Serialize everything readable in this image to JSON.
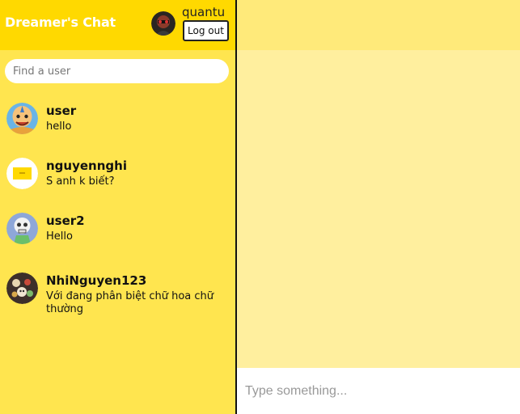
{
  "header": {
    "app_title": "Dreamer's Chat",
    "current_user": "quantu",
    "logout_label": "Log out"
  },
  "search": {
    "placeholder": "Find a user"
  },
  "contacts": [
    {
      "name": "user",
      "last_message": "hello",
      "avatar_icon": "cartoon-boy-avatar"
    },
    {
      "name": "nguyennghi",
      "last_message": "S anh k biết?",
      "avatar_icon": "yellow-card-avatar"
    },
    {
      "name": "user2",
      "last_message": "Hello",
      "avatar_icon": "skeleton-cartoon-avatar"
    },
    {
      "name": "NhiNguyen123",
      "last_message": "Với đang phân biệt chữ hoa chữ thường",
      "avatar_icon": "doodle-avatar"
    }
  ],
  "composer": {
    "placeholder": "Type something..."
  },
  "colors": {
    "header_yellow": "#ffd900",
    "sidebar_yellow": "#ffe54f",
    "chat_header": "#ffea7a",
    "chat_body": "#ffef9e",
    "divider": "#111111"
  }
}
